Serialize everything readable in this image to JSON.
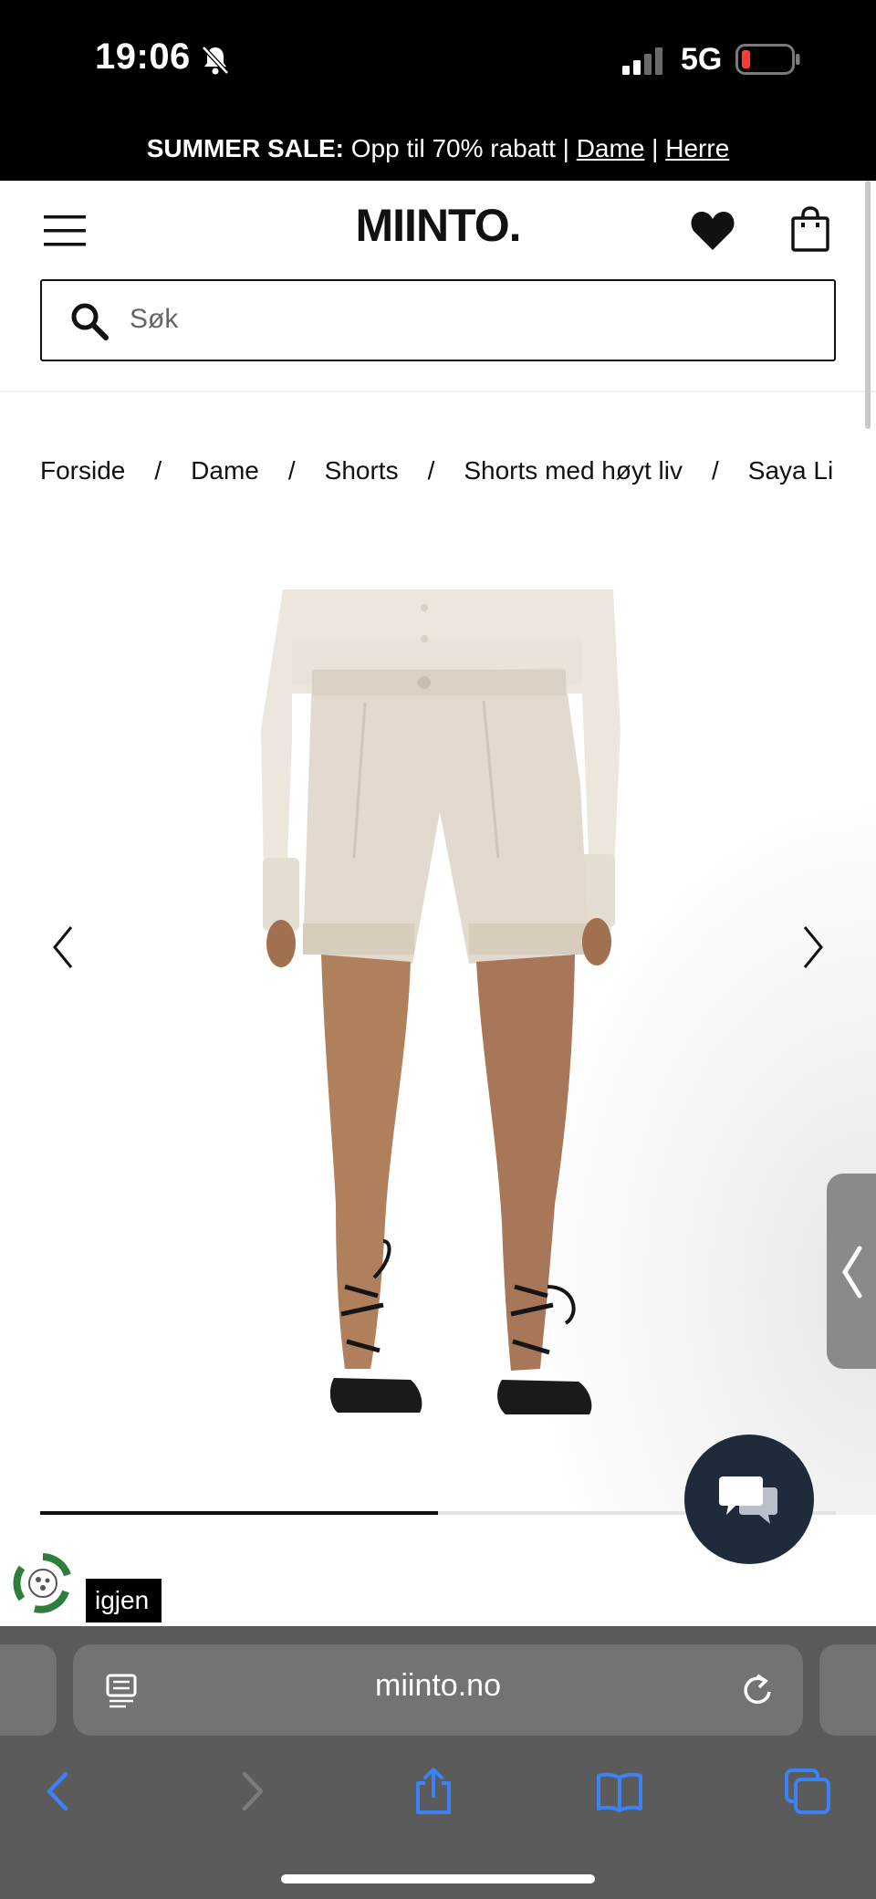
{
  "status_bar": {
    "time": "19:06",
    "network": "5G"
  },
  "promo": {
    "bold": "SUMMER SALE:",
    "text": " Opp til 70% rabatt | ",
    "link_women": "Dame",
    "separator": " | ",
    "link_men": "Herre"
  },
  "header": {
    "logo": "MIINTO.",
    "search_placeholder": "Søk"
  },
  "breadcrumb": {
    "items": [
      "Forside",
      "Dame",
      "Shorts",
      "Shorts med høyt liv",
      "Saya Li"
    ],
    "separator": "/"
  },
  "gallery": {
    "progress_fraction": 0.5,
    "again_label": "igjen"
  },
  "browser": {
    "url": "miinto.no"
  },
  "colors": {
    "promo_bg": "#000000",
    "chat_bg": "#1f2a3a",
    "safari_bg": "#5b5b5b",
    "ios_blue": "#3b82f6",
    "battery_low": "#ff3b30"
  }
}
